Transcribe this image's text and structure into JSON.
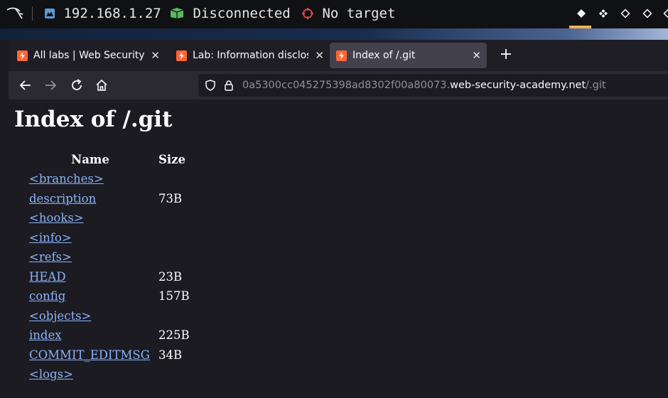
{
  "panel": {
    "ip": "192.168.1.27",
    "vpn_status": "Disconnected",
    "target": "No target",
    "workspaces": [
      "workspace-1",
      "workspace-2",
      "workspace-3",
      "workspace-4",
      "workspace-5"
    ],
    "active_workspace": 1,
    "colors": {
      "vpn_icon": "#5cb85c",
      "target_icon": "#e74c3c",
      "ip_icon": "#5b9bd5",
      "active_bar": "#f2b24c"
    }
  },
  "browser": {
    "tabs": [
      {
        "title": "All labs | Web Security Academy",
        "active": false
      },
      {
        "title": "Lab: Information disclosure in version control history",
        "active": false
      },
      {
        "title": "Index of /.git",
        "active": true
      }
    ],
    "address": {
      "prefix": "0a5300cc045275398ad8302f00a80073.",
      "domain": "web-security-academy.net",
      "path": "/.git"
    }
  },
  "page": {
    "heading": "Index of /.git",
    "columns": {
      "name": "Name",
      "size": "Size"
    },
    "entries": [
      {
        "name": "<branches>",
        "size": ""
      },
      {
        "name": "description",
        "size": "73B"
      },
      {
        "name": "<hooks>",
        "size": ""
      },
      {
        "name": "<info>",
        "size": ""
      },
      {
        "name": "<refs>",
        "size": ""
      },
      {
        "name": "HEAD",
        "size": "23B"
      },
      {
        "name": "config",
        "size": "157B"
      },
      {
        "name": "<objects>",
        "size": ""
      },
      {
        "name": "index",
        "size": "225B"
      },
      {
        "name": "COMMIT_EDITMSG",
        "size": "34B"
      },
      {
        "name": "<logs>",
        "size": ""
      }
    ]
  }
}
